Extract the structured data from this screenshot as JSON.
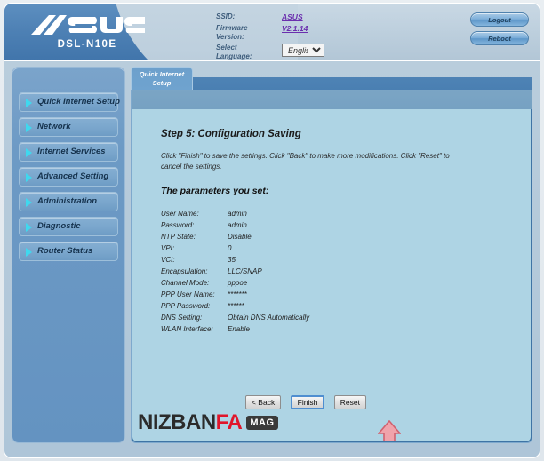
{
  "header": {
    "brand": "ASUS",
    "model": "DSL-N10E",
    "info_rows": [
      {
        "label": "SSID:",
        "value": "ASUS",
        "is_link": true
      },
      {
        "label": "Firmware Version:",
        "value": "V2.1.14",
        "is_link": true
      },
      {
        "label": "Select Language:",
        "value": "English",
        "is_link": false
      }
    ],
    "ssid_label": "SSID:",
    "ssid_value": "ASUS",
    "firmware_label_line1": "Firmware",
    "firmware_label_line2": "Version:",
    "firmware_value": "V2.1.14",
    "language_label": "Select Language:",
    "language_value": "English",
    "language_options": [
      "English"
    ],
    "logout_label": "Logout",
    "reboot_label": "Reboot"
  },
  "sidebar": {
    "items": [
      {
        "label": "Quick Internet Setup"
      },
      {
        "label": "Network"
      },
      {
        "label": "Internet Services"
      },
      {
        "label": "Advanced Setting"
      },
      {
        "label": "Administration"
      },
      {
        "label": "Diagnostic"
      },
      {
        "label": "Router Status"
      }
    ]
  },
  "tab": {
    "line1": "Quick Internet",
    "line2": "Setup"
  },
  "main": {
    "step_title": "Step 5: Configuration Saving",
    "intro_text": "Click \"Finish\" to save the settings. Click \"Back\" to make more modifications. Click \"Reset\" to cancel the settings.",
    "params_title": "The parameters you set:",
    "parameters": [
      {
        "name": "User Name:",
        "value": "admin"
      },
      {
        "name": "Password:",
        "value": "admin"
      },
      {
        "name": "NTP State:",
        "value": "Disable"
      },
      {
        "name": "VPI:",
        "value": "0"
      },
      {
        "name": "VCI:",
        "value": "35"
      },
      {
        "name": "Encapsulation:",
        "value": "LLC/SNAP"
      },
      {
        "name": "Channel Mode:",
        "value": "pppoe"
      },
      {
        "name": "PPP User Name:",
        "value": "*******"
      },
      {
        "name": "PPP Password:",
        "value": "******"
      },
      {
        "name": "DNS Setting:",
        "value": "Obtain DNS Automatically"
      },
      {
        "name": "WLAN Interface:",
        "value": "Enable"
      }
    ],
    "buttons": {
      "back": "< Back",
      "finish": "Finish",
      "reset": "Reset"
    }
  },
  "annotation": {
    "arrow_color": "#e8828c",
    "arrow_direction": "up"
  },
  "watermark": {
    "part1": "N",
    "part2": "IZBAN",
    "part3": "FA",
    "badge": "MAG"
  },
  "colors": {
    "header_blue": "#4d80b4",
    "sidebar_blue": "#6d9ac5",
    "panel_bg": "#aed4e4",
    "link_purple": "#6b2fae",
    "triangle_cyan": "#3fd8ee"
  }
}
